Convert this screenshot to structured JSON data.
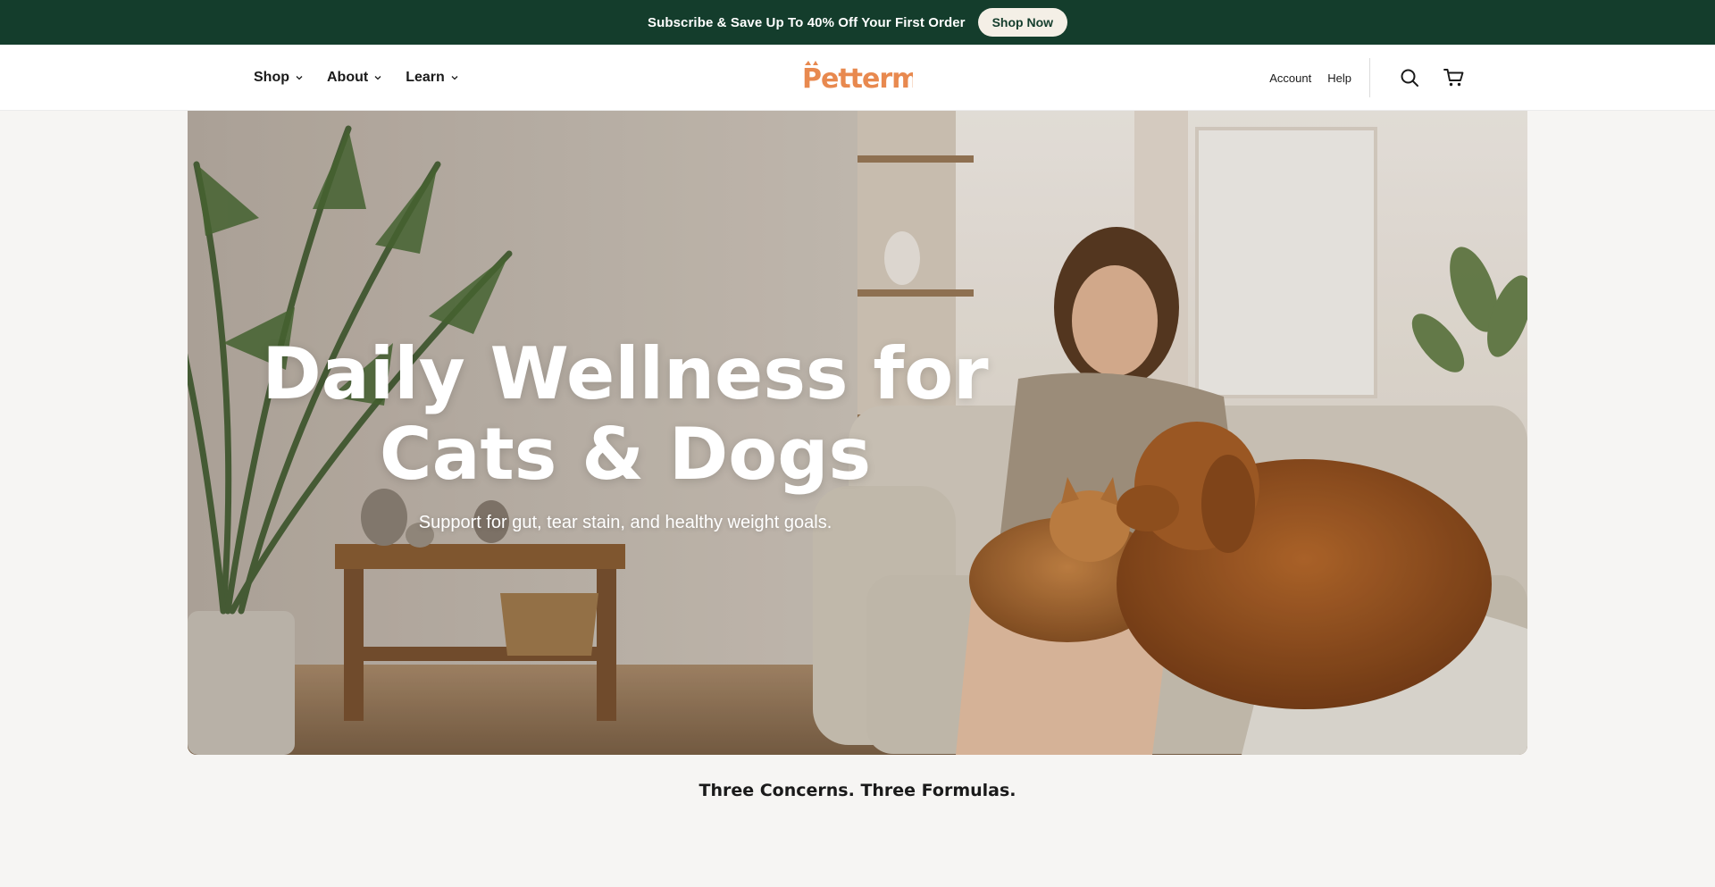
{
  "announcement": {
    "text": "Subscribe & Save Up To 40% Off Your First Order",
    "button_label": "Shop Now",
    "bg_color": "#143d2c"
  },
  "header": {
    "nav": [
      {
        "label": "Shop",
        "icon": "chevron-down-icon"
      },
      {
        "label": "About",
        "icon": "chevron-down-icon"
      },
      {
        "label": "Learn",
        "icon": "chevron-down-icon"
      }
    ],
    "logo_text": "Petterm",
    "logo_color": "#e8894f",
    "utility_links": [
      "Account",
      "Help"
    ],
    "icons": [
      "search-icon",
      "cart-icon"
    ]
  },
  "hero": {
    "title": "Daily Wellness for Cats & Dogs",
    "subtitle": "Support for gut, tear stain, and healthy weight goals.",
    "image_subject": "woman-with-cat-and-dog-on-sofa"
  },
  "section": {
    "heading": "Three Concerns. Three Formulas."
  }
}
